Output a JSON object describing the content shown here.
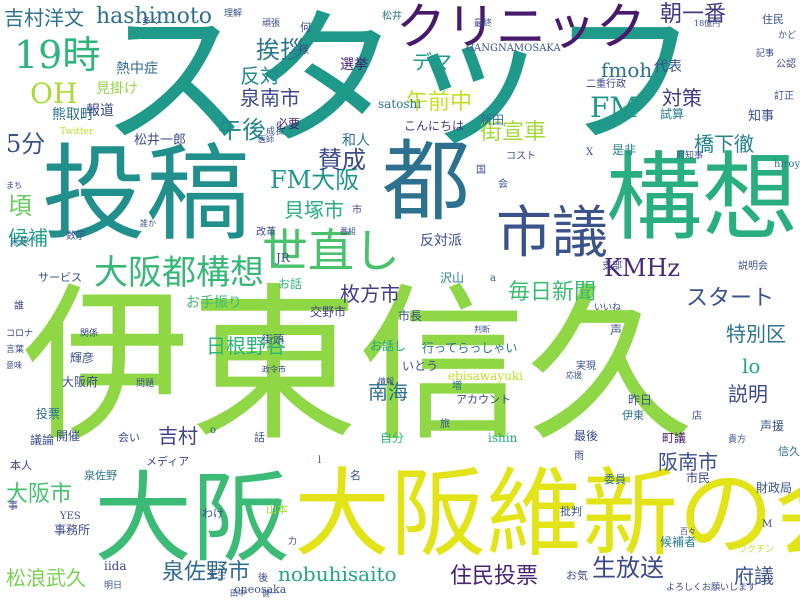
{
  "words": [
    {
      "text": "伊東信久",
      "color": "#8fd744"
    },
    {
      "text": "スタッフ",
      "color": "#1f9a8a"
    },
    {
      "text": "大阪維新の会",
      "color": "#e3e418"
    },
    {
      "text": "投稿",
      "color": "#21908d"
    },
    {
      "text": "構想",
      "color": "#29af7f"
    },
    {
      "text": "大阪",
      "color": "#3bbb75"
    },
    {
      "text": "都",
      "color": "#2c728e"
    },
    {
      "text": "クリニック",
      "color": "#481a6c"
    },
    {
      "text": "市議",
      "color": "#3b528b"
    },
    {
      "text": "世直し",
      "color": "#4ac16d"
    },
    {
      "text": "大阪都構想",
      "color": "#37b878"
    },
    {
      "text": "19時",
      "color": "#2fb47c"
    },
    {
      "text": "OH",
      "color": "#a8db34"
    },
    {
      "text": "hashimoto",
      "color": "#2e6f8e"
    },
    {
      "text": "吉村洋文",
      "color": "#2c728e"
    },
    {
      "text": "挨拶",
      "color": "#2a788e"
    },
    {
      "text": "朝一番",
      "color": "#443983"
    },
    {
      "text": "反対",
      "color": "#228c8d"
    },
    {
      "text": "泉南市",
      "color": "#3e4989"
    },
    {
      "text": "午後",
      "color": "#23898e"
    },
    {
      "text": "デマ",
      "color": "#1f9e89"
    },
    {
      "text": "fmoh",
      "color": "#2c728e"
    },
    {
      "text": "FM",
      "color": "#1f9a8a"
    },
    {
      "text": "午前中",
      "color": "#c2df23"
    },
    {
      "text": "街宣車",
      "color": "#a2da37"
    },
    {
      "text": "対策",
      "color": "#443a83"
    },
    {
      "text": "橋下徹",
      "color": "#25848e"
    },
    {
      "text": "5分",
      "color": "#3b528b"
    },
    {
      "text": "FM大阪",
      "color": "#1f988b"
    },
    {
      "text": "賛成",
      "color": "#3e4a89"
    },
    {
      "text": "頃",
      "color": "#65cb5e"
    },
    {
      "text": "貝塚市",
      "color": "#29af7f"
    },
    {
      "text": "KMHz",
      "color": "#482878"
    },
    {
      "text": "候補",
      "color": "#1f9e89"
    },
    {
      "text": "枚方市",
      "color": "#433e85"
    },
    {
      "text": "毎日新聞",
      "color": "#3dbc74"
    },
    {
      "text": "スタート",
      "color": "#3b528b"
    },
    {
      "text": "特別区",
      "color": "#2b748e"
    },
    {
      "text": "lo",
      "color": "#22a785"
    },
    {
      "text": "南海",
      "color": "#2e6f8e"
    },
    {
      "text": "阪南市",
      "color": "#3b528b"
    },
    {
      "text": "説明",
      "color": "#3e4c8a"
    },
    {
      "text": "吉村",
      "color": "#414487"
    },
    {
      "text": "日根野谷",
      "color": "#2fb47c"
    },
    {
      "text": "大阪市",
      "color": "#48c16e"
    },
    {
      "text": "泉佐野市",
      "color": "#2f6c8e"
    },
    {
      "text": "nobuhisaito",
      "color": "#21a585"
    },
    {
      "text": "住民投票",
      "color": "#482475"
    },
    {
      "text": "生放送",
      "color": "#3e4989"
    },
    {
      "text": "府議",
      "color": "#3b528b"
    },
    {
      "text": "松浪武久",
      "color": "#7ad151"
    },
    {
      "text": "サービス",
      "color": "#3b528b"
    },
    {
      "text": "和人",
      "color": "#2c728e"
    },
    {
      "text": "必要",
      "color": "#481a6c"
    },
    {
      "text": "熊取町",
      "color": "#2c728e"
    },
    {
      "text": "報道",
      "color": "#3e4989"
    },
    {
      "text": "見掛け",
      "color": "#8fd744"
    },
    {
      "text": "熱中症",
      "color": "#31688e"
    },
    {
      "text": "松井一郎",
      "color": "#3e4c8a"
    },
    {
      "text": "選挙",
      "color": "#482475"
    },
    {
      "text": "satoshi",
      "color": "#2c728e"
    },
    {
      "text": "こんにちは",
      "color": "#443983"
    },
    {
      "text": "新田",
      "color": "#2e6f8e"
    },
    {
      "text": "代表",
      "color": "#3b528b"
    },
    {
      "text": "試算",
      "color": "#287d8e"
    },
    {
      "text": "知事",
      "color": "#3b528b"
    },
    {
      "text": "是非",
      "color": "#287d8e"
    },
    {
      "text": "反対派",
      "color": "#3e4a89"
    },
    {
      "text": "JR",
      "color": "#3b528b"
    },
    {
      "text": "お手振り",
      "color": "#3dbc74"
    },
    {
      "text": "お話",
      "color": "#2fb47c"
    },
    {
      "text": "沢山",
      "color": "#25848e"
    },
    {
      "text": "交野市",
      "color": "#433e85"
    },
    {
      "text": "市長",
      "color": "#3b528b"
    },
    {
      "text": "お話し",
      "color": "#21a585"
    },
    {
      "text": "行ってらっしゃい",
      "color": "#2c728e"
    },
    {
      "text": "いとう",
      "color": "#3b528b"
    },
    {
      "text": "ebisawayuki",
      "color": "#c2df23"
    },
    {
      "text": "アカウント",
      "color": "#3e4989"
    },
    {
      "text": "昨日",
      "color": "#3b528b"
    },
    {
      "text": "伊東",
      "color": "#2c728e"
    },
    {
      "text": "輝彦",
      "color": "#3b528b"
    },
    {
      "text": "大阪府",
      "color": "#3e4989"
    },
    {
      "text": "投票",
      "color": "#2c728e"
    },
    {
      "text": "議論",
      "color": "#3b528b"
    },
    {
      "text": "開催",
      "color": "#3b528b"
    },
    {
      "text": "本人",
      "color": "#3e4989"
    },
    {
      "text": "泉佐野",
      "color": "#2c728e"
    },
    {
      "text": "メディア",
      "color": "#3e4989"
    },
    {
      "text": "自分",
      "color": "#2fb47c"
    },
    {
      "text": "ishin",
      "color": "#22a785"
    },
    {
      "text": "最後",
      "color": "#3b528b"
    },
    {
      "text": "町議",
      "color": "#481a6c"
    },
    {
      "text": "声援",
      "color": "#3b528b"
    },
    {
      "text": "信久",
      "color": "#2c728e"
    },
    {
      "text": "市民",
      "color": "#3e4989"
    },
    {
      "text": "財政局",
      "color": "#3b528b"
    },
    {
      "text": "事務所",
      "color": "#3e4989"
    },
    {
      "text": "山本",
      "color": "#a8db34"
    },
    {
      "text": "わけ",
      "color": "#3b528b"
    },
    {
      "text": "iida",
      "color": "#3e4989"
    },
    {
      "text": "oneosaka",
      "color": "#3b528b"
    },
    {
      "text": "候補者",
      "color": "#287d8e"
    },
    {
      "text": "お気",
      "color": "#3e4989"
    },
    {
      "text": "批判",
      "color": "#3b528b"
    },
    {
      "text": "委員",
      "color": "#2c728e"
    },
    {
      "text": "名",
      "color": "#3b528b"
    },
    {
      "text": "GANGNAMOSAKA",
      "color": "#3b528b"
    },
    {
      "text": "hiroyoshimura",
      "color": "#2c728e"
    },
    {
      "text": "説明会",
      "color": "#3b528b"
    },
    {
      "text": "支部",
      "color": "#3e4989"
    },
    {
      "text": "公認",
      "color": "#3e4989"
    },
    {
      "text": "訂正",
      "color": "#3b528b"
    },
    {
      "text": "住民",
      "color": "#3b528b"
    },
    {
      "text": "何",
      "color": "#3e4989"
    },
    {
      "text": "様",
      "color": "#3b528b"
    },
    {
      "text": "松井",
      "color": "#2c728e"
    },
    {
      "text": "話",
      "color": "#3b528b"
    },
    {
      "text": "会い",
      "color": "#3e4989"
    },
    {
      "text": "旅",
      "color": "#3b528b"
    },
    {
      "text": "雨",
      "color": "#3e4989"
    },
    {
      "text": "店",
      "color": "#3b528b"
    },
    {
      "text": "増",
      "color": "#2c728e"
    },
    {
      "text": "実現",
      "color": "#3b528b"
    },
    {
      "text": "市",
      "color": "#3e4989"
    },
    {
      "text": "会",
      "color": "#3b528b"
    },
    {
      "text": "国",
      "color": "#3e4989"
    },
    {
      "text": "コスト",
      "color": "#3b528b"
    },
    {
      "text": "改革",
      "color": "#3e4989"
    },
    {
      "text": "未来",
      "color": "#2c728e"
    },
    {
      "text": "数字",
      "color": "#3b528b"
    },
    {
      "text": "二重行政",
      "color": "#3e4989"
    },
    {
      "text": "YES",
      "color": "#3b528b"
    },
    {
      "text": "M",
      "color": "#3e4989"
    },
    {
      "text": "a",
      "color": "#3b528b"
    },
    {
      "text": "X",
      "color": "#3b528b"
    },
    {
      "text": "l",
      "color": "#3b528b"
    },
    {
      "text": "o",
      "color": "#3b528b"
    },
    {
      "text": "事",
      "color": "#3e4989"
    },
    {
      "text": "先生",
      "color": "#3b528b"
    },
    {
      "text": "後",
      "color": "#3e4989"
    },
    {
      "text": "明日",
      "color": "#3b528b"
    },
    {
      "text": "力",
      "color": "#3e4989"
    },
    {
      "text": "成長",
      "color": "#3b528b"
    },
    {
      "text": "記事",
      "color": "#3e4989"
    },
    {
      "text": "理解",
      "color": "#3b528b"
    },
    {
      "text": "多く",
      "color": "#3e4989"
    },
    {
      "text": "最終",
      "color": "#3b528b"
    },
    {
      "text": "頑張",
      "color": "#3e4989"
    },
    {
      "text": "Twitter",
      "color": "#c2df23"
    },
    {
      "text": "貴方",
      "color": "#3b528b"
    },
    {
      "text": "府知事",
      "color": "#3b528b"
    },
    {
      "text": "関係",
      "color": "#3e4989"
    },
    {
      "text": "問題",
      "color": "#3b528b"
    },
    {
      "text": "コロナ",
      "color": "#3e4989"
    },
    {
      "text": "言葉",
      "color": "#3b528b"
    },
    {
      "text": "意味",
      "color": "#3e4989"
    },
    {
      "text": "判断",
      "color": "#3b528b"
    },
    {
      "text": "情報",
      "color": "#3e4989"
    },
    {
      "text": "応援",
      "color": "#3b528b"
    },
    {
      "text": "よろしくお願いします",
      "color": "#3e4989"
    },
    {
      "text": "百々",
      "color": "#3b528b"
    },
    {
      "text": "ワクチン",
      "color": "#c2df23"
    },
    {
      "text": "かど",
      "color": "#3b528b"
    },
    {
      "text": "政令市",
      "color": "#3e4989"
    },
    {
      "text": "街頭",
      "color": "#3b528b"
    },
    {
      "text": "誰",
      "color": "#3e4989"
    },
    {
      "text": "声",
      "color": "#3b528b"
    },
    {
      "text": "いいね",
      "color": "#3e4989"
    },
    {
      "text": "18億円",
      "color": "#3b528b"
    },
    {
      "text": "番組",
      "color": "#3e4989"
    },
    {
      "text": "医師",
      "color": "#3b528b"
    },
    {
      "text": "まち",
      "color": "#3e4989"
    },
    {
      "text": "誰か",
      "color": "#3b528b"
    },
    {
      "text": "田中",
      "color": "#3e4989"
    },
    {
      "text": "健一",
      "color": "#3b528b"
    }
  ]
}
